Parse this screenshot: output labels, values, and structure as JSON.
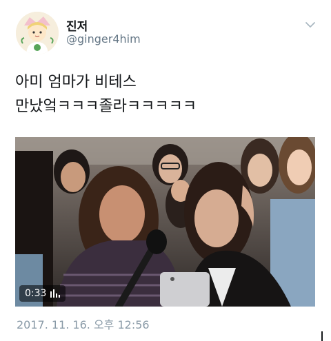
{
  "tweet": {
    "author": {
      "display_name": "진저",
      "handle": "@ginger4him",
      "avatar_icon": "cartoon-avatar-icon"
    },
    "menu_icon": "chevron-down-icon",
    "text_lines": [
      "아미 엄마가 비테스",
      "만났엌ㅋㅋㅋ졸라ㅋㅋㅋㅋㅋ"
    ],
    "media": {
      "type": "video",
      "duration": "0:33",
      "volume_icon": "audio-bars-icon"
    },
    "timestamp": "2017. 11. 16. 오후 12:56"
  },
  "colors": {
    "text": "#14171a",
    "secondary": "#657786",
    "timestamp": "#8899a6"
  }
}
